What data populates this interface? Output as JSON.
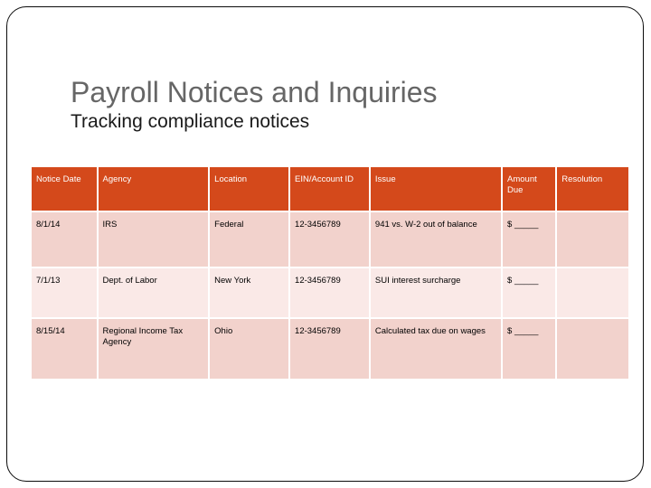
{
  "slide": {
    "title": "Payroll Notices and Inquiries",
    "subtitle": "Tracking compliance notices",
    "title_color": "#666666",
    "subtitle_color": "#1a1a1a",
    "frame_color": "#0b0b0b",
    "background": "#ffffff"
  },
  "table": {
    "header_bg": "#D4491B",
    "header_text_color": "#ffffff",
    "row_bg_odd": "#F2D2CC",
    "row_bg_even": "#FAE9E7",
    "columns": [
      "Notice Date",
      "Agency",
      "Location",
      "EIN/Account ID",
      "Issue",
      "Amount Due",
      "Resolution"
    ],
    "rows": [
      {
        "notice_date": "8/1/14",
        "agency": "IRS",
        "location": "Federal",
        "ein_account_id": "12-3456789",
        "issue": "941 vs. W-2 out of balance",
        "amount_due": "$ _____",
        "resolution": ""
      },
      {
        "notice_date": "7/1/13",
        "agency": "Dept. of Labor",
        "location": "New York",
        "ein_account_id": "12-3456789",
        "issue": "SUI interest surcharge",
        "amount_due": "$ _____",
        "resolution": ""
      },
      {
        "notice_date": "8/15/14",
        "agency": "Regional Income Tax Agency",
        "location": "Ohio",
        "ein_account_id": "12-3456789",
        "issue": "Calculated tax due on wages",
        "amount_due": "$ _____",
        "resolution": ""
      }
    ]
  }
}
